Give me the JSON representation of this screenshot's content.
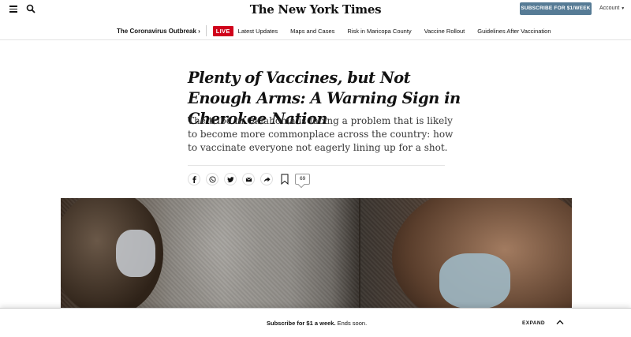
{
  "header": {
    "logo": "The New York Times",
    "subscribe_label": "SUBSCRIBE FOR $1/WEEK",
    "account_label": "Account"
  },
  "section_nav": {
    "title": "The Coronavirus Outbreak ›",
    "live_badge": "LIVE",
    "links": [
      "Latest Updates",
      "Maps and Cases",
      "Risk in Maricopa County",
      "Vaccine Rollout",
      "Guidelines After Vaccination"
    ]
  },
  "article": {
    "headline": "Plenty of Vaccines, but Not Enough Arms: A Warning Sign in Cherokee Nation",
    "summary": "The tribe in Oklahoma is facing a problem that is likely to become more commonplace across the country: how to vaccinate everyone not eagerly lining up for a shot.",
    "comment_count": "69",
    "share_icons": [
      "facebook-icon",
      "whatsapp-icon",
      "twitter-icon",
      "email-icon",
      "share-arrow-icon"
    ]
  },
  "bottom_bar": {
    "message_bold": "Subscribe for $1 a week.",
    "message_rest": " Ends soon.",
    "expand_label": "EXPAND"
  },
  "colors": {
    "subscribe_button": "#567b95",
    "live_badge": "#d0021b"
  }
}
